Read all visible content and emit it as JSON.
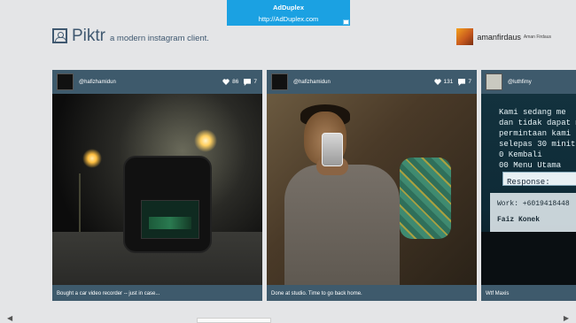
{
  "ad": {
    "title": "AdDuplex",
    "url": "http://AdDuplex.com"
  },
  "app": {
    "name": "Piktr",
    "tagline": "a modern instagram client."
  },
  "user": {
    "username": "amanfirdaus",
    "full_name": "Aman Firdaus"
  },
  "cards": [
    {
      "username": "@hafizhamidun",
      "likes": "86",
      "comments": "7",
      "caption": "Bought a car video recorder -- just in case..."
    },
    {
      "username": "@hafizhamidun",
      "likes": "131",
      "comments": "7",
      "caption": "Done at studio. Time to go back home."
    },
    {
      "username": "@luthfimy",
      "caption": "Wtf Maxis",
      "screen_lines": [
        "Kami sedang me",
        "dan tidak dapat m",
        "permintaan kami",
        "selepas 30 minit.",
        "0 Kembali",
        "00 Menu Utama"
      ],
      "response_label": "Response:",
      "list_lines": [
        "Work: +6019418448",
        "Faiz Konek"
      ]
    }
  ],
  "icons": {
    "like": "heart-icon",
    "comment": "comment-icon",
    "scroll_left": "chevron-left-icon",
    "scroll_right": "chevron-right-icon"
  },
  "colors": {
    "background": "#e4e5e7",
    "card": "#3e5a6c",
    "brand": "#3f5870",
    "ad": "#1ba1e2"
  }
}
